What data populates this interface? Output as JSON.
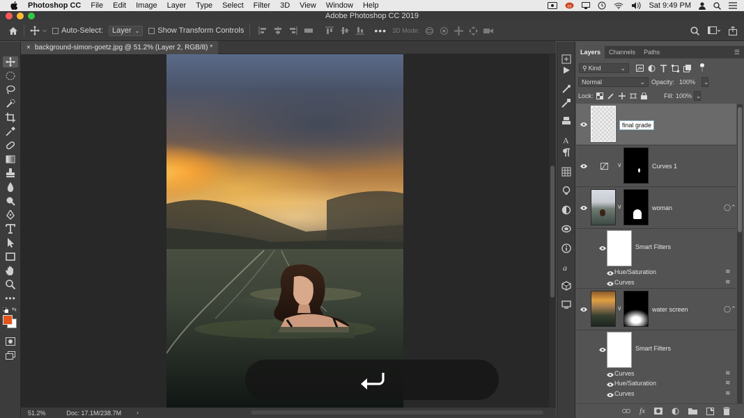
{
  "menubar": {
    "app_name": "Photoshop CC",
    "items": [
      "File",
      "Edit",
      "Image",
      "Layer",
      "Type",
      "Select",
      "Filter",
      "3D",
      "View",
      "Window",
      "Help"
    ],
    "clock": "Sat 9:49 PM"
  },
  "window": {
    "title": "Adobe Photoshop CC 2019"
  },
  "options_bar": {
    "auto_select_label": "Auto-Select:",
    "auto_select_target": "Layer",
    "transform_controls_label": "Show Transform Controls",
    "mode_3d_label": "3D Mode:"
  },
  "document": {
    "tab_title": "background-simon-goetz.jpg @ 51.2% (Layer 2, RGB/8) *",
    "zoom": "51.2%",
    "doc_size": "Doc: 17.1M/238.7M"
  },
  "layers_panel": {
    "tabs": [
      "Layers",
      "Channels",
      "Paths"
    ],
    "active_tab": "Layers",
    "filter_kind": "Kind",
    "blend_mode": "Normal",
    "opacity_label": "Opacity:",
    "opacity_value": "100%",
    "lock_label": "Lock:",
    "fill_label": "Fill:",
    "fill_value": "100%",
    "layers": [
      {
        "name": "final grade",
        "editing": true
      },
      {
        "name": "Curves 1"
      },
      {
        "name": "woman"
      },
      {
        "name": "Smart Filters"
      },
      {
        "name": "Hue/Saturation"
      },
      {
        "name": "Curves"
      },
      {
        "name": "water screen"
      },
      {
        "name": "Smart Filters"
      },
      {
        "name": "Curves"
      },
      {
        "name": "Hue/Saturation"
      },
      {
        "name": "Curves"
      }
    ]
  },
  "colors": {
    "foreground": "#e2561b",
    "background": "#ffffff",
    "selected_layer": "#6a6a6a",
    "panel_bg": "#535353"
  },
  "icons": [
    "move-tool-icon",
    "marquee-icon",
    "lasso-icon",
    "quick-select-icon",
    "crop-icon",
    "eyedropper-icon",
    "healing-icon",
    "brush-icon",
    "stamp-icon",
    "history-brush-icon",
    "eraser-icon",
    "gradient-icon",
    "blur-icon",
    "dodge-icon",
    "pen-icon",
    "type-icon",
    "path-select-icon",
    "rectangle-icon",
    "hand-icon",
    "zoom-icon",
    "undo-arrow-icon"
  ]
}
